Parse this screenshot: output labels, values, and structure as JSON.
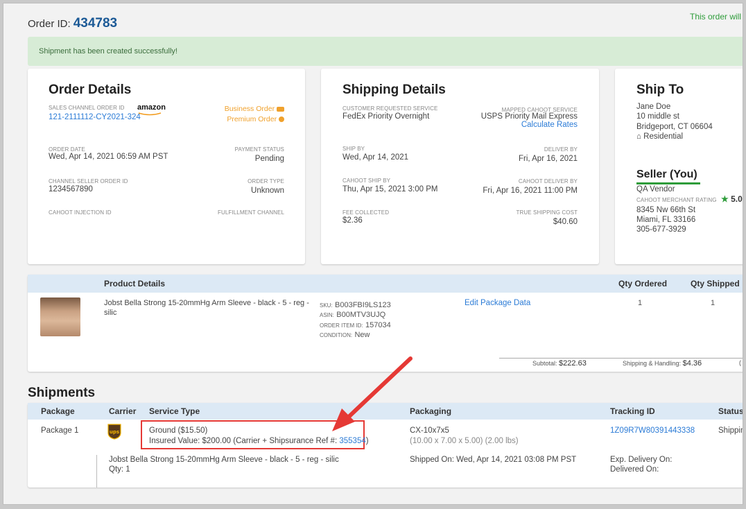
{
  "header": {
    "order_label": "Order ID:",
    "order_id": "434783",
    "top_right_note": "This order will"
  },
  "alert": {
    "message": "Shipment has been created successfully!"
  },
  "order_details": {
    "title": "Order Details",
    "sales_channel_label": "SALES CHANNEL ORDER ID",
    "sales_channel_value": "121-2111112-CY2021-324",
    "channel_logo": "amazon",
    "business_order": "Business Order",
    "premium_order": "Premium Order",
    "order_date_label": "ORDER DATE",
    "order_date_value": "Wed, Apr 14, 2021 06:59 AM PST",
    "payment_status_label": "PAYMENT STATUS",
    "payment_status_value": "Pending",
    "channel_seller_label": "CHANNEL SELLER ORDER ID",
    "channel_seller_value": "1234567890",
    "order_type_label": "ORDER TYPE",
    "order_type_value": "Unknown",
    "injection_label": "CAHOOT INJECTION ID",
    "fulfillment_label": "FULFILLMENT CHANNEL"
  },
  "shipping_details": {
    "title": "Shipping Details",
    "requested_label": "CUSTOMER REQUESTED SERVICE",
    "requested_value": "FedEx Priority Overnight",
    "mapped_label": "MAPPED CAHOOT SERVICE",
    "mapped_value": "USPS Priority Mail Express",
    "calculate_rates": "Calculate Rates",
    "ship_by_label": "SHIP BY",
    "ship_by_value": "Wed, Apr 14, 2021",
    "deliver_by_label": "DELIVER BY",
    "deliver_by_value": "Fri, Apr 16, 2021",
    "cahoot_ship_label": "CAHOOT SHIP BY",
    "cahoot_ship_value": "Thu, Apr 15, 2021 3:00 PM",
    "cahoot_deliver_label": "CAHOOT DELIVER BY",
    "cahoot_deliver_value": "Fri, Apr 16, 2021 11:00 PM",
    "fee_label": "FEE COLLECTED",
    "fee_value": "$2.36",
    "true_cost_label": "TRUE SHIPPING COST",
    "true_cost_value": "$40.60"
  },
  "ship_to": {
    "title": "Ship To",
    "name": "Jane Doe",
    "street": "10 middle st",
    "city": "Bridgeport, CT 06604",
    "type": "Residential"
  },
  "seller": {
    "title": "Seller (You)",
    "name": "QA Vendor",
    "rating_label": "CAHOOT MERCHANT RATING",
    "rating_value": "5.0",
    "street": "8345 Nw 66th St",
    "city": "Miami, FL 33166",
    "phone": "305-677-3929"
  },
  "products": {
    "headers": {
      "details": "Product Details",
      "qty_ordered": "Qty Ordered",
      "qty_shipped": "Qty Shipped"
    },
    "item": {
      "name_line1": "Jobst Bella Strong 15-20mmHg Arm Sleeve - black - 5 - reg -",
      "name_line2": "silic",
      "sku_label": "SKU:",
      "sku": "B003FBI9LS123",
      "asin_label": "ASIN:",
      "asin": "B00MTV3UJQ",
      "order_item_label": "ORDER ITEM ID:",
      "order_item": "157034",
      "condition_label": "CONDITION:",
      "condition": "New",
      "edit_link": "Edit Package Data",
      "qty_ordered": "1",
      "qty_shipped": "1"
    },
    "subtotal_label": "Subtotal:",
    "subtotal": "$222.63",
    "handling_label": "Shipping & Handling:",
    "handling": "$4.36",
    "cut_char": "("
  },
  "shipments": {
    "title": "Shipments",
    "headers": {
      "package": "Package",
      "carrier": "Carrier",
      "service": "Service Type",
      "packaging": "Packaging",
      "tracking": "Tracking ID",
      "status": "Status"
    },
    "row": {
      "package": "Package 1",
      "carrier_logo": "ups",
      "service": "Ground ($15.50)",
      "insured_prefix": "Insured Value: $200.00 (Carrier + Shipsurance Ref #:",
      "insured_ref": "355354",
      "insured_suffix": ")",
      "packaging": "CX-10x7x5",
      "dimensions": "(10.00 x 7.00 x 5.00) (2.00 lbs)",
      "tracking": "1Z09R7W80391443338",
      "status": "Shippin",
      "item_name": "Jobst Bella Strong 15-20mmHg Arm Sleeve - black - 5 - reg - silic",
      "qty": "Qty: 1",
      "shipped_on": "Shipped On: Wed, Apr 14, 2021 03:08 PM PST",
      "exp_delivery": "Exp. Delivery On:",
      "delivered_on": "Delivered On:"
    }
  },
  "colors": {
    "accent_blue": "#2b7bd6",
    "success_green": "#2e9c3a",
    "highlight_red": "#e53935",
    "orange": "#f0a12c"
  }
}
